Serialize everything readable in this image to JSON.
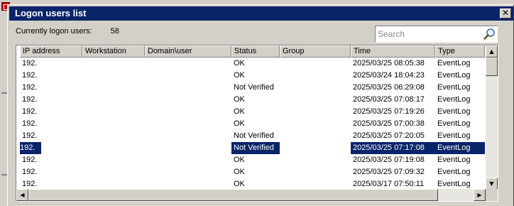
{
  "window": {
    "title": "Logon users list",
    "close_glyph": "✕"
  },
  "summary": {
    "label": "Currently logon users:",
    "count": "58"
  },
  "search": {
    "placeholder": "Search",
    "value": ""
  },
  "table": {
    "columns": [
      "IP address",
      "Workstation",
      "Domain\\user",
      "Status",
      "Group",
      "Time",
      "Type"
    ],
    "rows": [
      {
        "ip": "192.",
        "workstation": "",
        "domain_user": "",
        "status": "OK",
        "group": "",
        "time": "2025/03/25 08:05:38",
        "type": "EventLog"
      },
      {
        "ip": "192.",
        "workstation": "",
        "domain_user": "",
        "status": "OK",
        "group": "",
        "time": "2025/03/24 18:04:23",
        "type": "EventLog"
      },
      {
        "ip": "192.",
        "workstation": "",
        "domain_user": "",
        "status": "Not Verified",
        "group": "",
        "time": "2025/03/25 06:29:08",
        "type": "EventLog"
      },
      {
        "ip": "192.",
        "workstation": "",
        "domain_user": "",
        "status": "OK",
        "group": "",
        "time": "2025/03/25 07:08:17",
        "type": "EventLog"
      },
      {
        "ip": "192.",
        "workstation": "",
        "domain_user": "",
        "status": "OK",
        "group": "",
        "time": "2025/03/25 07:19:26",
        "type": "EventLog"
      },
      {
        "ip": "192.",
        "workstation": "",
        "domain_user": "",
        "status": "OK",
        "group": "",
        "time": "2025/03/25 07:00:38",
        "type": "EventLog"
      },
      {
        "ip": "192.",
        "workstation": "",
        "domain_user": "",
        "status": "Not Verified",
        "group": "",
        "time": "2025/03/25 07:20:05",
        "type": "EventLog"
      },
      {
        "ip": "192.",
        "workstation": "",
        "domain_user": "",
        "status": "Not Verified",
        "group": "",
        "time": "2025/03/25 07:17:08",
        "type": "EventLog",
        "selected": true
      },
      {
        "ip": "192.",
        "workstation": "",
        "domain_user": "",
        "status": "OK",
        "group": "",
        "time": "2025/03/25 07:19:08",
        "type": "EventLog"
      },
      {
        "ip": "192.",
        "workstation": "",
        "domain_user": "",
        "status": "OK",
        "group": "",
        "time": "2025/03/25 07:09:32",
        "type": "EventLog"
      },
      {
        "ip": "192.",
        "workstation": "",
        "domain_user": "",
        "status": "OK",
        "group": "",
        "time": "2025/03/17 07:50:11",
        "type": "EventLog"
      }
    ]
  },
  "scrollbars": {
    "up": "▲",
    "down": "▼",
    "left": "◀",
    "right": "▶"
  },
  "colors": {
    "selection": "#0a246a",
    "titlebar": "#0a246a"
  },
  "icons": {
    "close": "close-icon",
    "search": "magnifier-search-icon",
    "app": "app-icon"
  }
}
